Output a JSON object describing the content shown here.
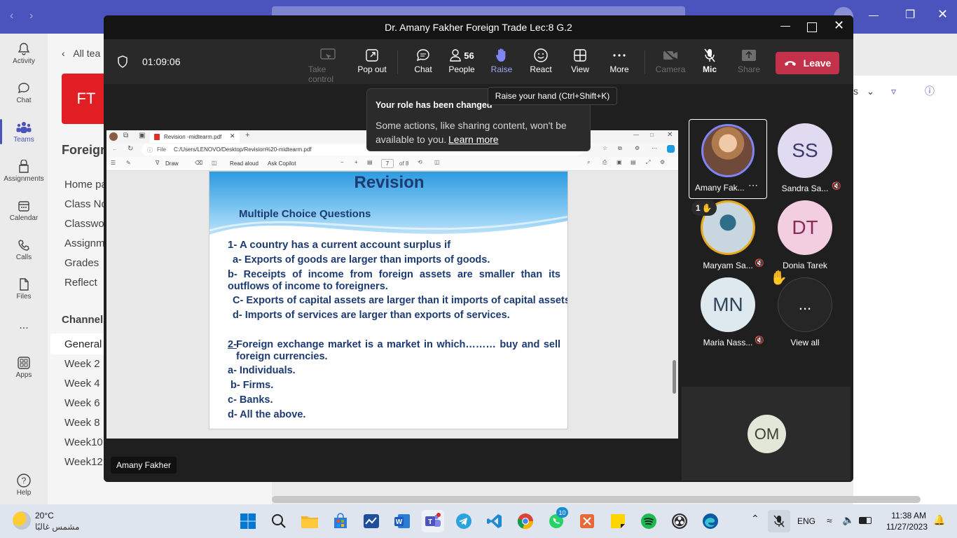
{
  "outer": {
    "rail": [
      {
        "label": "Activity",
        "icon": "bell-icon"
      },
      {
        "label": "Chat",
        "icon": "chat-icon"
      },
      {
        "label": "Teams",
        "icon": "teams-icon"
      },
      {
        "label": "Assignments",
        "icon": "assignments-icon"
      },
      {
        "label": "Calendar",
        "icon": "calendar-icon"
      },
      {
        "label": "Calls",
        "icon": "phone-icon"
      },
      {
        "label": "Files",
        "icon": "file-icon"
      },
      {
        "label": "...",
        "icon": "more-icon"
      },
      {
        "label": "Apps",
        "icon": "apps-icon"
      },
      {
        "label": "Help",
        "icon": "help-icon"
      }
    ],
    "back_label": "All tea",
    "team_tile": "FT",
    "team_name": "Foreign",
    "nav": [
      "Home pa",
      "Class Not",
      "Classwor",
      "Assignme",
      "Grades",
      "Reflect"
    ],
    "channels_label": "Channels",
    "channels": [
      "General",
      "Week 2",
      "Week 4",
      "Week 6",
      "Week 8",
      "Week10",
      "Week12"
    ],
    "right_partial": "s"
  },
  "meeting": {
    "title": "Dr. Amany Fakher Foreign Trade Lec:8 G.2",
    "timer": "01:09:06",
    "toolbar": {
      "take_control": "Take control",
      "pop_out": "Pop out",
      "chat": "Chat",
      "people": "People",
      "people_count": "56",
      "raise": "Raise",
      "react": "React",
      "view": "View",
      "more": "More",
      "camera": "Camera",
      "mic": "Mic",
      "share": "Share",
      "leave": "Leave"
    },
    "tooltip": "Raise your hand (Ctrl+Shift+K)",
    "popup": {
      "title": "Your role has been changed",
      "body": "Some actions, like sharing content, won't be available to you.",
      "link": "Learn more"
    },
    "presenter_tag": "Amany Fakher",
    "participants": [
      {
        "name": "Amany Fak...",
        "initials": "",
        "color": "#7b4a3a",
        "has_photo": true
      },
      {
        "name": "Sandra Sa...",
        "initials": "SS",
        "color": "#e0dbf1",
        "text_color": "#3b3a6b"
      },
      {
        "name": "Maryam Sa...",
        "initials": "",
        "color": "#9bb6c7",
        "has_photo": true,
        "hand_count": "1"
      },
      {
        "name": "Donia Tarek",
        "initials": "DT",
        "color": "#f3cde0",
        "text_color": "#8a2b54"
      },
      {
        "name": "Maria Nass...",
        "initials": "MN",
        "color": "#dde8ef",
        "text_color": "#30475a"
      },
      {
        "name": "View all",
        "initials": "...",
        "color": "#333333",
        "text_color": "#ffffff"
      }
    ],
    "self_initials": "OM"
  },
  "pdf": {
    "tab_title": "Revision -midtearm.pdf",
    "file_label": "File",
    "path": "C:/Users/LENOVO/Desktop/Revision%20-midtearm.pdf",
    "draw": "Draw",
    "read_aloud": "Read aloud",
    "ask_copilot": "Ask Copilot",
    "page": "7",
    "of_pages": "of 8",
    "slide": {
      "title": "Revision",
      "subtitle": "Multiple Choice Questions",
      "q1": "1- A country has a current account surplus if",
      "q1a": "a- Exports of goods are larger than imports of goods.",
      "q1b": "b- Receipts of income from foreign assets are smaller than its outflows of income to foreigners.",
      "q1c": "C- Exports of capital assets are larger than it imports of capital assets.",
      "q1d": "d- Imports of services are larger than exports of services.",
      "q2_num": "2-",
      "q2": "Foreign exchange market is a market in which……… buy and sell foreign currencies.",
      "q2a": "a- Individuals.",
      "q2b": "b- Firms.",
      "q2c": "c- Banks.",
      "q2d": "d- All the above."
    }
  },
  "taskbar": {
    "weather_temp": "20°C",
    "weather_desc": "مشمس غالبًا",
    "lang": "ENG",
    "time": "11:38 AM",
    "date": "11/27/2023",
    "whatsapp_badge": "10"
  }
}
